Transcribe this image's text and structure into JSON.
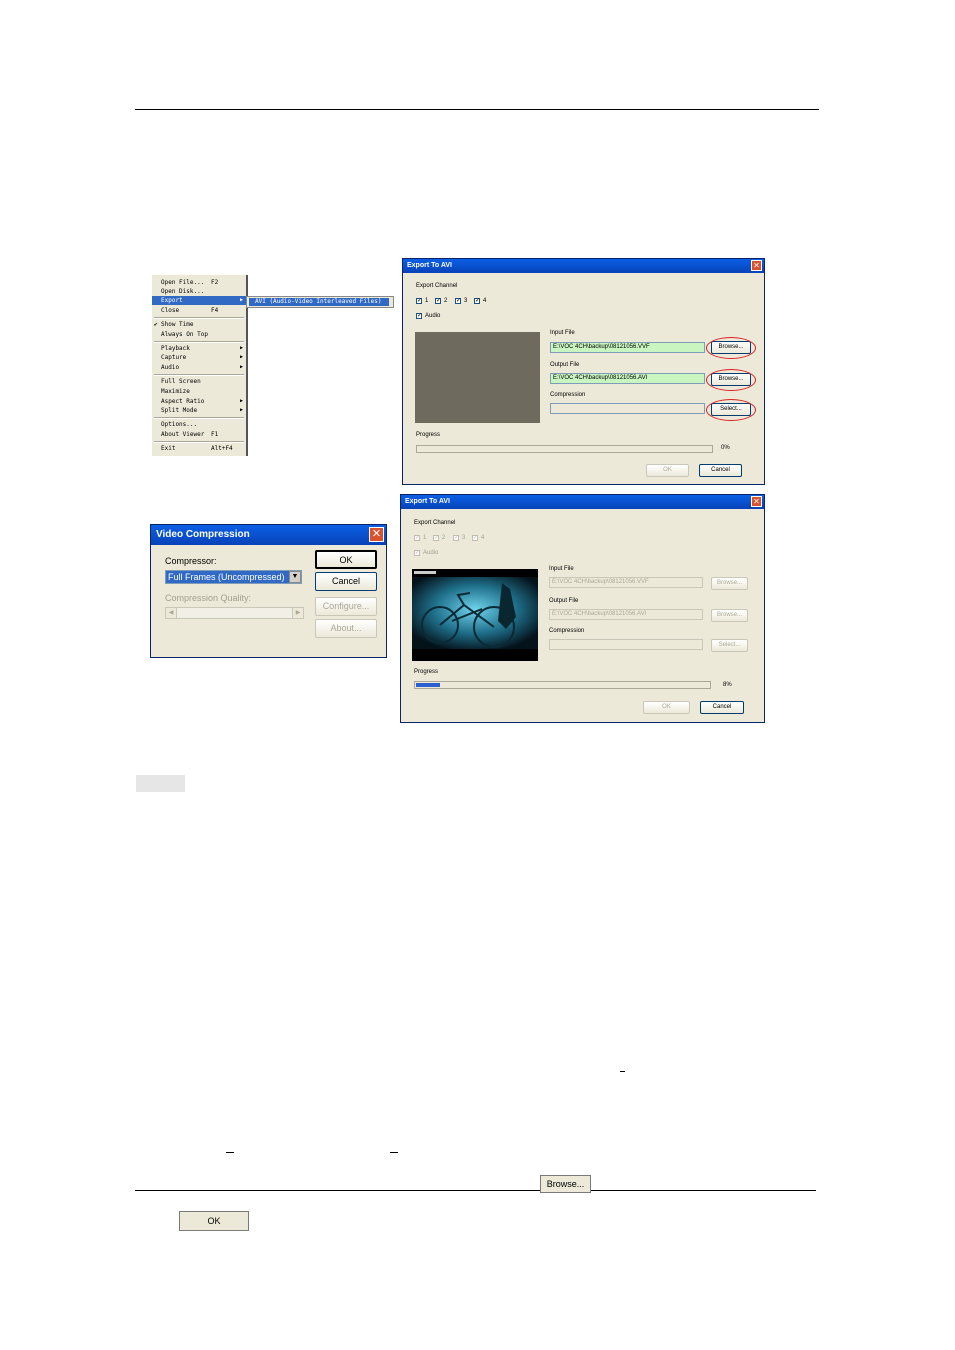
{
  "menu": {
    "items": [
      {
        "label": "Open File...",
        "accel": "F2"
      },
      {
        "label": "Open Disk...",
        "accel": ""
      },
      {
        "label": "Export",
        "accel": "",
        "submenu": true,
        "selected": true
      },
      {
        "label": "Close",
        "accel": "F4"
      },
      {
        "label": "Show Time",
        "accel": "",
        "checked": true
      },
      {
        "label": "Always On Top",
        "accel": ""
      },
      {
        "label": "Playback",
        "accel": "",
        "submenu": true
      },
      {
        "label": "Capture",
        "accel": "",
        "submenu": true
      },
      {
        "label": "Audio",
        "accel": "",
        "submenu": true
      },
      {
        "label": "Full Screen",
        "accel": ""
      },
      {
        "label": "Maximize",
        "accel": ""
      },
      {
        "label": "Aspect Ratio",
        "accel": "",
        "submenu": true
      },
      {
        "label": "Split Mode",
        "accel": "",
        "submenu": true
      },
      {
        "label": "Options...",
        "accel": ""
      },
      {
        "label": "About Viewer",
        "accel": "F1"
      },
      {
        "label": "Exit",
        "accel": "Alt+F4"
      }
    ],
    "submenu_item": "AVI (Audio-Video Interleaved Files)"
  },
  "export1": {
    "title": "Export To AVI",
    "export_channel": "Export Channel",
    "channels": [
      "1",
      "2",
      "3",
      "4"
    ],
    "audio": "Audio",
    "input_file_label": "Input File",
    "input_file": "E:\\VOC 4CH\\backup\\08121056.VVF",
    "output_file_label": "Output File",
    "output_file": "E:\\VOC 4CH\\backup\\08121056.AVI",
    "compression_label": "Compression",
    "compression": "",
    "browse": "Browse...",
    "select": "Select...",
    "progress_label": "Progress",
    "progress_value": 0,
    "progress_text": "0%",
    "ok": "OK",
    "cancel": "Cancel"
  },
  "export2": {
    "title": "Export To AVI",
    "export_channel": "Export Channel",
    "channels": [
      "1",
      "2",
      "3",
      "4"
    ],
    "audio": "Audio",
    "input_file_label": "Input File",
    "input_file": "E:\\VOC 4CH\\backup\\08121056.VVF",
    "output_file_label": "Output File",
    "output_file": "E:\\VOC 4CH\\backup\\08121056.AVI",
    "compression_label": "Compression",
    "compression": "",
    "browse": "Browse...",
    "select": "Select...",
    "progress_label": "Progress",
    "progress_value": 0.08,
    "progress_text": "8%",
    "ok": "OK",
    "cancel": "Cancel"
  },
  "video_compression": {
    "title": "Video Compression",
    "compressor_label": "Compressor:",
    "compressor_value": "Full Frames (Uncompressed)",
    "quality_label": "Compression Quality:",
    "ok": "OK",
    "cancel": "Cancel",
    "configure": "Configure...",
    "about": "About..."
  },
  "inline_buttons": {
    "browse": "Browse...",
    "ok": "OK"
  }
}
